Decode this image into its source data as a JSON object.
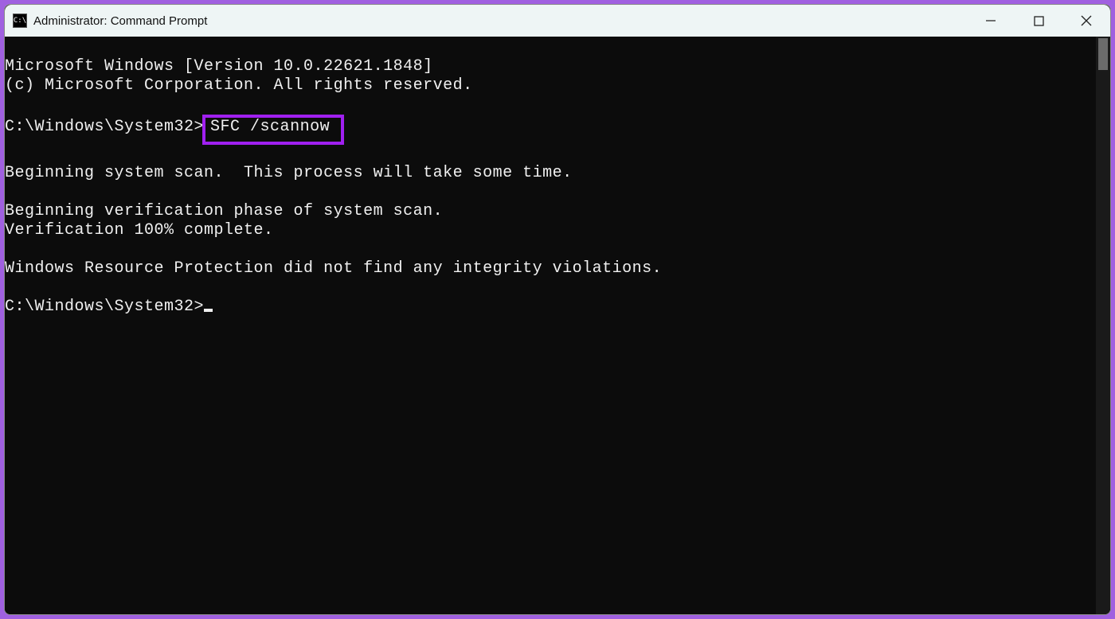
{
  "window": {
    "title": "Administrator: Command Prompt",
    "icon_label": "C:\\"
  },
  "term": {
    "header1": "Microsoft Windows [Version 10.0.22621.1848]",
    "header2": "(c) Microsoft Corporation. All rights reserved.",
    "blank": "",
    "prompt1_prefix": "C:\\Windows\\System32>",
    "prompt1_cmd": "SFC /scannow",
    "scan_begin": "Beginning system scan.  This process will take some time.",
    "verify_phase": "Beginning verification phase of system scan.",
    "verify_done": "Verification 100% complete.",
    "result": "Windows Resource Protection did not find any integrity violations.",
    "prompt2": "C:\\Windows\\System32>"
  },
  "colors": {
    "highlight_border": "#a020f0",
    "terminal_bg": "#0c0c0c",
    "terminal_fg": "#f0f0f0",
    "titlebar_bg": "#eef5f5"
  }
}
